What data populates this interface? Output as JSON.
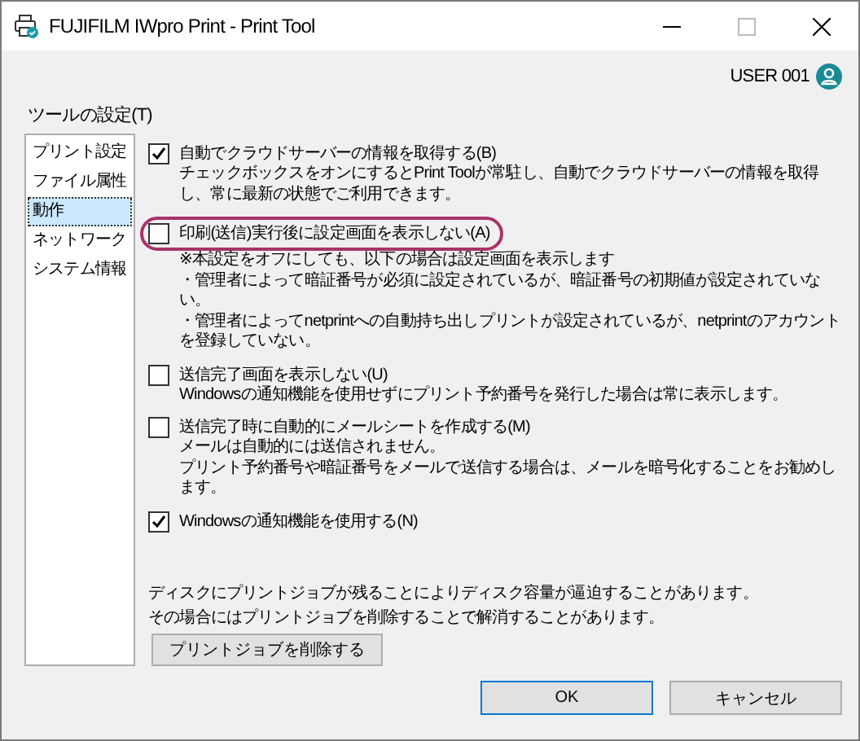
{
  "window": {
    "title": "FUJIFILM IWpro Print - Print Tool"
  },
  "user": {
    "name": "USER 001"
  },
  "sidebar": {
    "label": "ツールの設定(T)",
    "items": [
      {
        "label": "プリント設定",
        "selected": false
      },
      {
        "label": "ファイル属性",
        "selected": false
      },
      {
        "label": "動作",
        "selected": true
      },
      {
        "label": "ネットワーク",
        "selected": false
      },
      {
        "label": "システム情報",
        "selected": false
      }
    ]
  },
  "options": [
    {
      "label": "自動でクラウドサーバーの情報を取得する(B)",
      "checked": true,
      "highlighted": false,
      "notes": [
        "チェックボックスをオンにするとPrint Toolが常駐し、自動でクラウドサーバーの情報を取得し、常に最新の状態でご利用できます。"
      ]
    },
    {
      "label": "印刷(送信)実行後に設定画面を表示しない(A)",
      "checked": false,
      "highlighted": true,
      "notes": [
        "※本設定をオフにしても、以下の場合は設定画面を表示します",
        "・管理者によって暗証番号が必須に設定されているが、暗証番号の初期値が設定されていない。",
        "・管理者によってnetprintへの自動持ち出しプリントが設定されているが、netprintのアカウントを登録していない。"
      ]
    },
    {
      "label": "送信完了画面を表示しない(U)",
      "checked": false,
      "highlighted": false,
      "notes": [
        "Windowsの通知機能を使用せずにプリント予約番号を発行した場合は常に表示します。"
      ]
    },
    {
      "label": "送信完了時に自動的にメールシートを作成する(M)",
      "checked": false,
      "highlighted": false,
      "notes": [
        "メールは自動的には送信されません。",
        "プリント予約番号や暗証番号をメールで送信する場合は、メールを暗号化することをお勧めします。"
      ]
    },
    {
      "label": "Windowsの通知機能を使用する(N)",
      "checked": true,
      "highlighted": false
    }
  ],
  "disk_notice": [
    "ディスクにプリントジョブが残ることによりディスク容量が逼迫することがあります。",
    "その場合にはプリントジョブを削除することで解消することがあります。"
  ],
  "delete_button": "プリントジョブを削除する",
  "buttons": [
    {
      "label": "OK",
      "default": true
    },
    {
      "label": "キャンセル",
      "default": false
    }
  ]
}
